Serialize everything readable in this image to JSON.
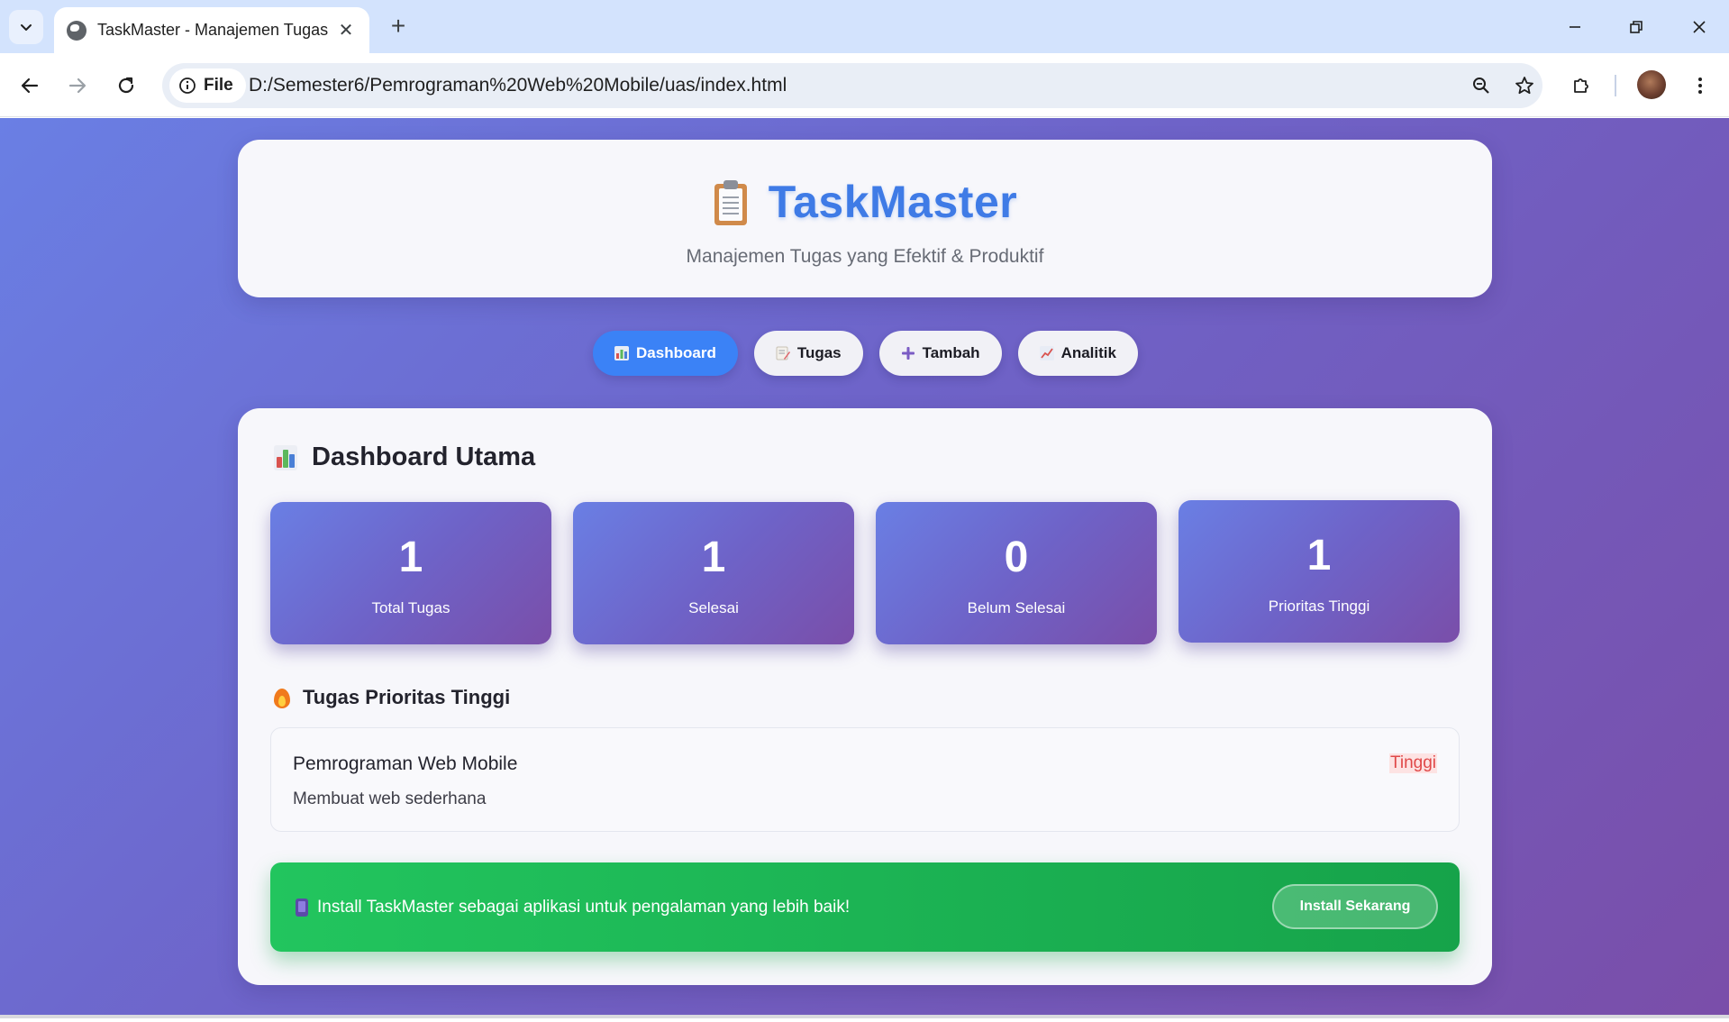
{
  "browser": {
    "tab_title": "TaskMaster - Manajemen Tugas",
    "chip_label": "File",
    "url": "D:/Semester6/Pemrograman%20Web%20Mobile/uas/index.html",
    "close_glyph": "✕",
    "new_tab_glyph": "+"
  },
  "header": {
    "app_name": "TaskMaster",
    "tagline": "Manajemen Tugas yang Efektif & Produktif",
    "icon": "clipboard-icon"
  },
  "nav": {
    "items": [
      {
        "label": "Dashboard",
        "icon": "bar-chart-icon",
        "active": true
      },
      {
        "label": "Tugas",
        "icon": "memo-icon",
        "active": false
      },
      {
        "label": "Tambah",
        "icon": "plus-icon",
        "active": false
      },
      {
        "label": "Analitik",
        "icon": "line-chart-icon",
        "active": false
      }
    ]
  },
  "dashboard": {
    "title": "Dashboard Utama",
    "stats": [
      {
        "value": "1",
        "label": "Total Tugas"
      },
      {
        "value": "1",
        "label": "Selesai"
      },
      {
        "value": "0",
        "label": "Belum Selesai"
      },
      {
        "value": "1",
        "label": "Prioritas Tinggi"
      }
    ],
    "priority_title": "Tugas Prioritas Tinggi",
    "tasks": [
      {
        "name": "Pemrograman Web Mobile",
        "description": "Membuat web sederhana",
        "priority": "Tinggi"
      }
    ]
  },
  "install": {
    "message": "Install TaskMaster sebagai aplikasi untuk pengalaman yang lebih baik!",
    "button_label": "Install Sekarang"
  },
  "colors": {
    "accent_blue": "#3b82f6",
    "gradient_start": "#6a7fe4",
    "gradient_end": "#7a4ea9",
    "install_green": "#22c55e",
    "priority_red": "#e04848"
  }
}
